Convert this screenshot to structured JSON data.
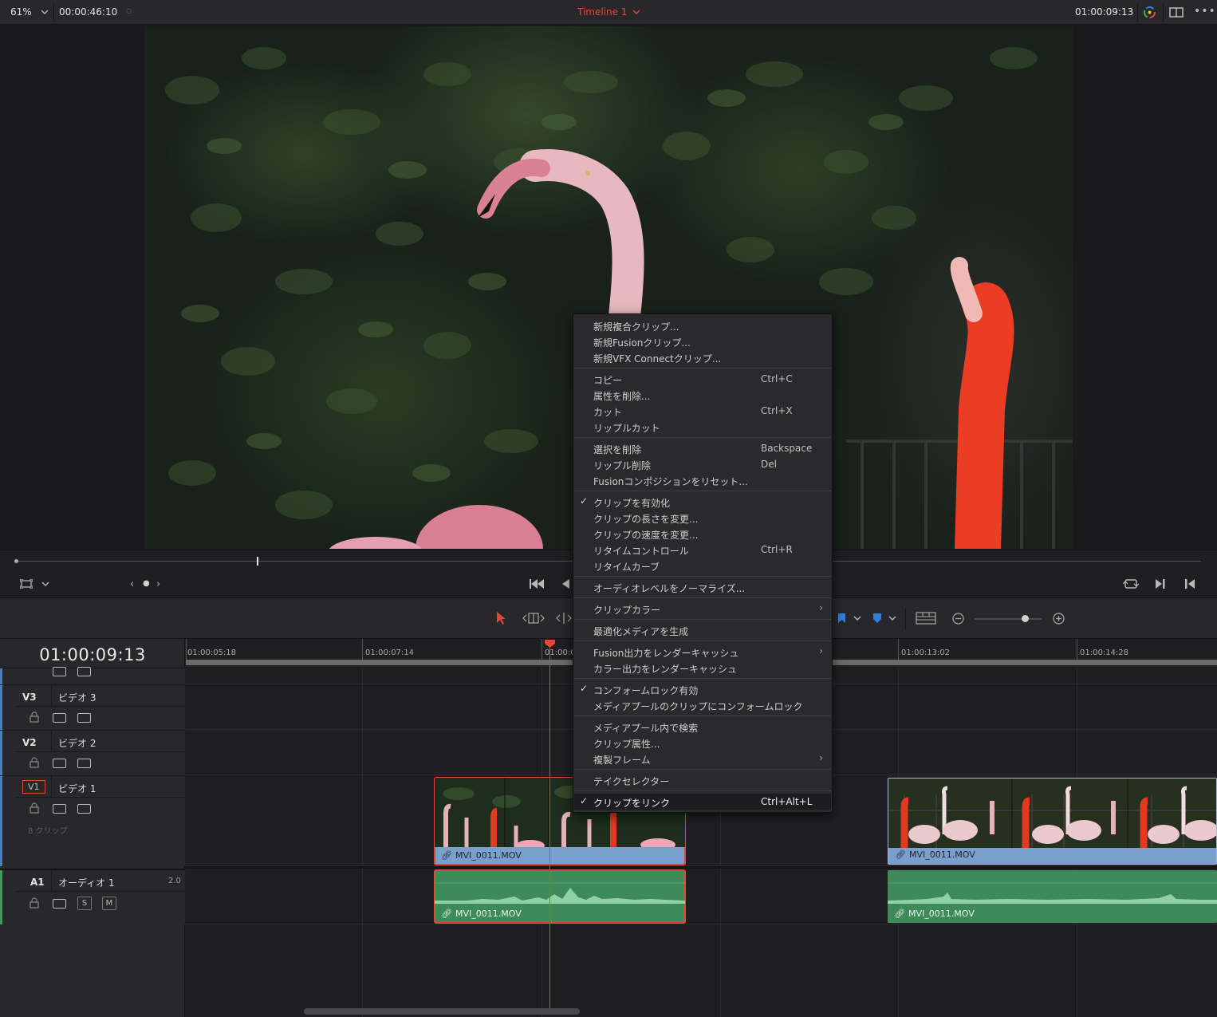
{
  "topbar": {
    "zoom": "61%",
    "duration": "00:00:46:10",
    "timeline_name": "Timeline 1",
    "timecode": "01:00:09:13"
  },
  "timeline": {
    "current_timecode": "01:00:09:13",
    "ruler": [
      "01:00:05:18",
      "01:00:07:14",
      "01:00:09:13",
      "01:00:13:02",
      "01:00:14:28"
    ],
    "tracks": {
      "v3": {
        "tag": "V3",
        "name": "ビデオ 3"
      },
      "v2": {
        "tag": "V2",
        "name": "ビデオ 2"
      },
      "v1": {
        "tag": "V1",
        "name": "ビデオ 1",
        "count": "8 クリップ"
      },
      "a1": {
        "tag": "A1",
        "name": "オーディオ 1",
        "channels": "2.0",
        "solo": "S",
        "mute": "M"
      }
    },
    "clips": {
      "v1_clip1": "MVI_0011.MOV",
      "v1_clip2": "MVI_0011.MOV",
      "a1_clip1": "MVI_0011.MOV",
      "a1_clip2": "MVI_0011.MOV"
    }
  },
  "context_menu": {
    "groups": [
      [
        {
          "label": "新規複合クリップ..."
        },
        {
          "label": "新規Fusionクリップ..."
        },
        {
          "label": "新規VFX Connectクリップ..."
        }
      ],
      [
        {
          "label": "コピー",
          "shortcut": "Ctrl+C"
        },
        {
          "label": "属性を削除..."
        },
        {
          "label": "カット",
          "shortcut": "Ctrl+X"
        },
        {
          "label": "リップルカット"
        }
      ],
      [
        {
          "label": "選択を削除",
          "shortcut": "Backspace"
        },
        {
          "label": "リップル削除",
          "shortcut": "Del"
        },
        {
          "label": "Fusionコンポジションをリセット..."
        }
      ],
      [
        {
          "label": "クリップを有効化",
          "checked": true
        },
        {
          "label": "クリップの長さを変更..."
        },
        {
          "label": "クリップの速度を変更..."
        },
        {
          "label": "リタイムコントロール",
          "shortcut": "Ctrl+R"
        },
        {
          "label": "リタイムカーブ"
        }
      ],
      [
        {
          "label": "オーディオレベルをノーマライズ..."
        }
      ],
      [
        {
          "label": "クリップカラー",
          "submenu": true
        }
      ],
      [
        {
          "label": "最適化メディアを生成"
        }
      ],
      [
        {
          "label": "Fusion出力をレンダーキャッシュ",
          "submenu": true
        },
        {
          "label": "カラー出力をレンダーキャッシュ"
        }
      ],
      [
        {
          "label": "コンフォームロック有効",
          "checked": true
        },
        {
          "label": "メディアプールのクリップにコンフォームロック"
        }
      ],
      [
        {
          "label": "メディアプール内で検索"
        },
        {
          "label": "クリップ属性..."
        },
        {
          "label": "複製フレーム",
          "submenu": true
        }
      ],
      [
        {
          "label": "テイクセレクター"
        }
      ],
      [
        {
          "label": "クリップをリンク",
          "shortcut": "Ctrl+Alt+L",
          "checked": true,
          "highlighted": true
        }
      ]
    ]
  },
  "colors": {
    "accent_red": "#e0483a",
    "video_clip": "#7b9fcc",
    "audio_clip": "#3f8a5a",
    "marker_blue": "#2f7fe0"
  }
}
